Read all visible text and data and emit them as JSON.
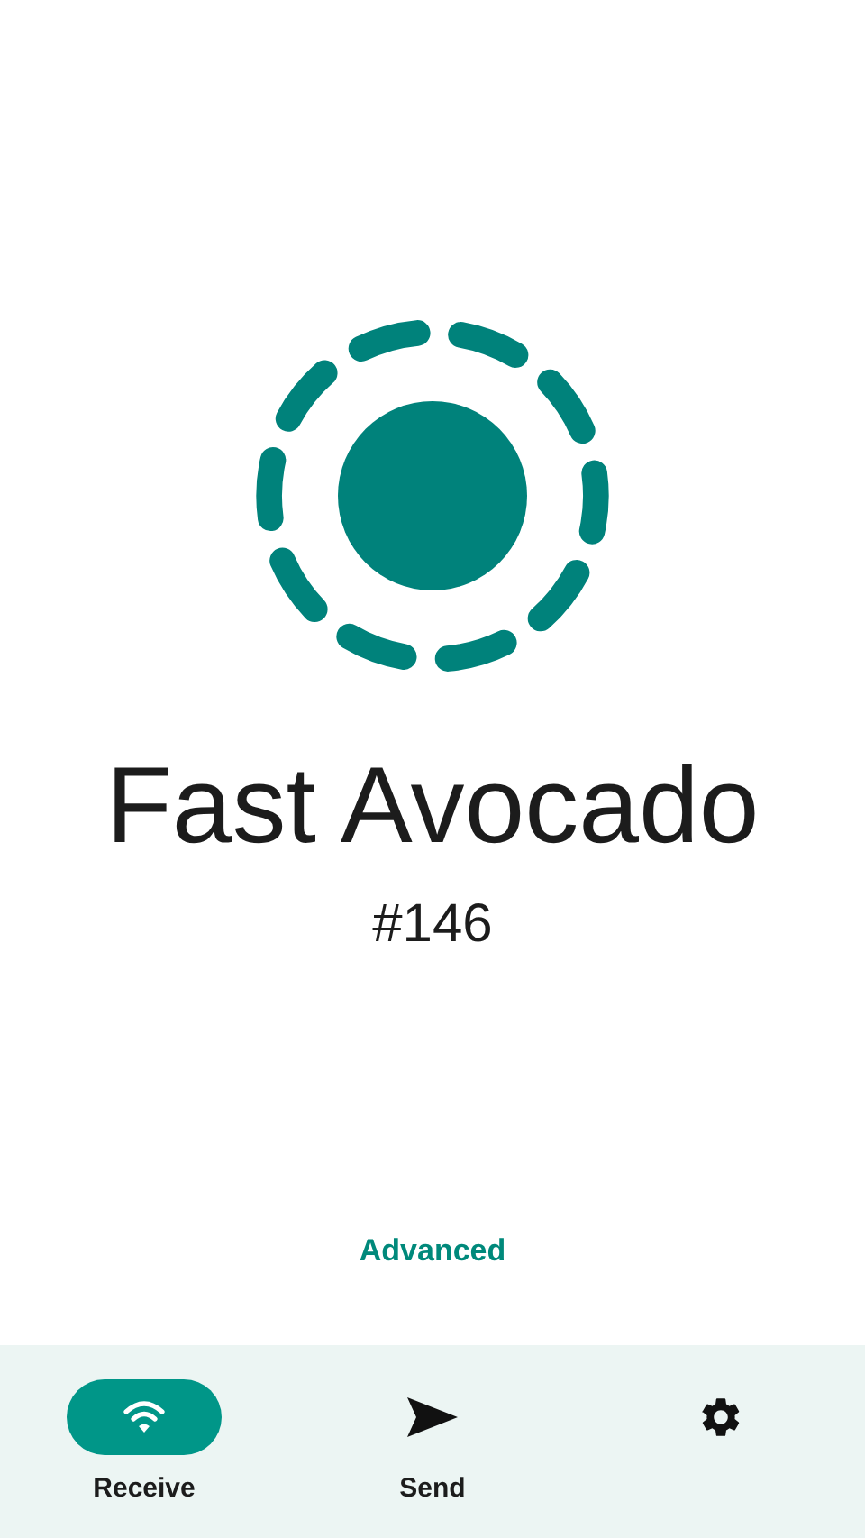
{
  "device": {
    "name": "Fast Avocado",
    "number": "#146"
  },
  "advanced_link": "Advanced",
  "nav": [
    {
      "kind": "receive",
      "label": "Receive",
      "selected": true
    },
    {
      "kind": "send",
      "label": "Send",
      "selected": false
    },
    {
      "kind": "settings",
      "selected": false
    }
  ]
}
